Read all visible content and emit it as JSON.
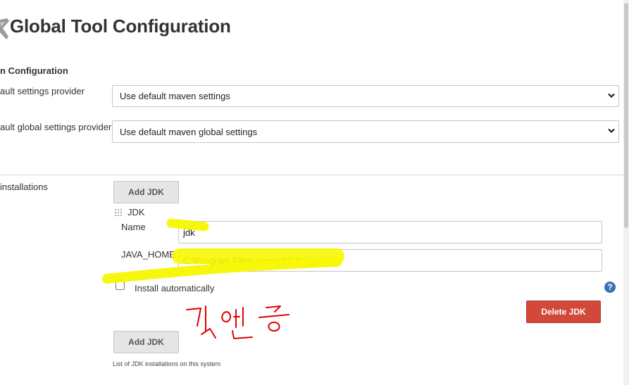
{
  "header": {
    "title": "Global Tool Configuration"
  },
  "maven": {
    "section_title": "n Configuration",
    "settings_label": "ault settings provider",
    "settings_value": "Use default maven settings",
    "global_settings_label": "ault global settings provider",
    "global_settings_value": "Use default maven global settings"
  },
  "jdk": {
    "installations_label": " installations",
    "add_button": "Add JDK",
    "block_title": "JDK",
    "name_label": "Name",
    "name_value": "jdk",
    "java_home_label": "JAVA_HOME",
    "java_home_value": "C:\\Program Files\\Java\\jdk1.8.0_241",
    "install_auto_label": "Install automatically",
    "install_auto_checked": false,
    "delete_button": "Delete JDK",
    "add_button_bottom": "Add JDK",
    "hint": "List of JDK installations on this system"
  },
  "colors": {
    "highlight": "#f7f700",
    "annotation": "#e00000",
    "delete": "#d24939"
  },
  "icons": {
    "logo": "wrench-icon",
    "select": "chevron-down-icon",
    "help": "help-icon",
    "drag": "drag-handle-icon"
  }
}
